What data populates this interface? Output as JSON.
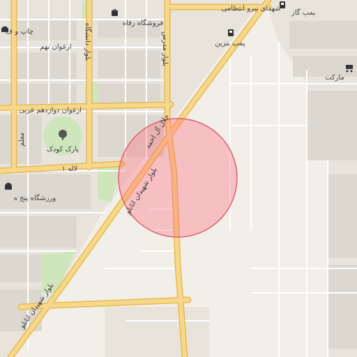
{
  "colors": {
    "land": "#f2efe9",
    "urban": "#e8e4dc",
    "block": "#ddd8cf",
    "minor_road": "#ffffff",
    "main_road": "#f7d88a",
    "main_road_casing": "#e6b954",
    "park": "#cfe6bd",
    "radius_fill": "#ff6b7a",
    "radius_stroke": "#e06070",
    "label": "#444444",
    "road_label": "#3a3a3a"
  },
  "labels": {
    "shahada_niro": "شهدای نیرو انتظامی",
    "pomp_gaz": "پمپ گاز",
    "forushgah_refah": "فروشگاه رفاه",
    "chap": "چاپ و ف",
    "pomp_benzin": "پمپ بنزین",
    "arghavan_nohom": "ارغوان نهم",
    "bolvar_modares": "بلوار مدرس",
    "bolvar_daneshgah": "بلوار دانشگاه",
    "market": "مارکت",
    "arghavan_12": "ارغوان دوازدهم غربی",
    "jalal": "جلال آل احمد",
    "moallem": "معلم",
    "park_kudak": "پارک کودک",
    "laleh": "لاله ۱",
    "bolvar_atomi": "بلوار شهیدان اتانلو",
    "bolvar_atomi_2": "بلوار شهیدان اتانلو",
    "varzeshgah": "ورزشگاه پنج ه"
  }
}
